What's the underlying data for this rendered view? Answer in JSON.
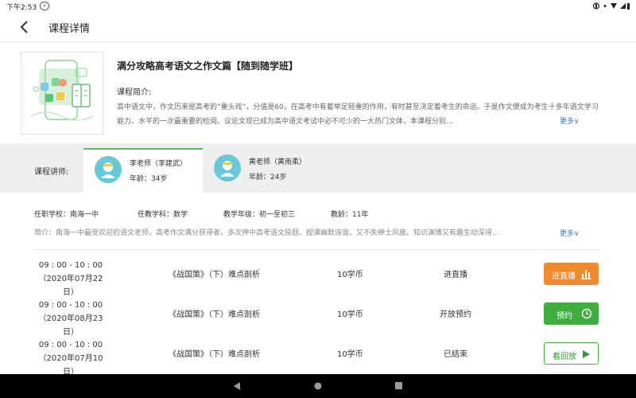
{
  "status_bar": {
    "time": "下午2:53",
    "badge": "»"
  },
  "header": {
    "title": "课程详情"
  },
  "course": {
    "title": "满分攻略高考语文之作文篇【随到随学班】",
    "intro_label": "课程简介:",
    "intro_text": "高中语文中，作文历来是高考的“重头戏”，分值是60，在高考中有着举足轻重的作用，有时甚至决定着考生的命运。于是作文便成为考生十多年语文学习能力、水平的一次最重要的检阅。议论文现已成为高中语文考试中必不可少的一大热门文体，本课程分别...",
    "more": "更多∨"
  },
  "teachers": {
    "label": "课程讲师:",
    "items": [
      {
        "name": "李老师（李建武）",
        "age": "年龄：34岁"
      },
      {
        "name": "黄老师（黄雨柔）",
        "age": "年龄：24岁"
      }
    ]
  },
  "teacher_detail": {
    "school": "任职学校：南海一中",
    "subject": "任教学科：数学",
    "grade": "教学年级：初一至初三",
    "years": "教龄：11年",
    "intro": "简介：南海一中最受欢迎的语文老师，高考作文满分获得者，多次押中高考语文原题。授课幽默诙谐，又不失绅士风度。知识渊博又有趣生动深得...",
    "more": "更多∨"
  },
  "lessons": [
    {
      "time": "09 : 00 - 10 : 00",
      "date": "（2020年07月22日）",
      "name": "《战国策》（下）难点剖析",
      "price": "10学币",
      "status": "进直播",
      "button": "进直播"
    },
    {
      "time": "09 : 00 - 10 : 00",
      "date": "（2020年08月23日）",
      "name": "《战国策》（下）难点剖析",
      "price": "10学币",
      "status": "开放预约",
      "button": "预约"
    },
    {
      "time": "09 : 00 - 10 : 00",
      "date": "（2020年07月10日）",
      "name": "《战国策》（下）难点剖析",
      "price": "10学币",
      "status": "已结束",
      "button": "看回放"
    }
  ],
  "icons": {
    "back": "arrow-left-icon",
    "live": "bars-icon",
    "reserve": "clock-icon",
    "replay": "play-icon"
  },
  "colors": {
    "accent_green": "#3fae3f",
    "live_orange": "#f08a2e",
    "link_blue": "#3a7bd5",
    "avatar_teal": "#68c8d8"
  }
}
